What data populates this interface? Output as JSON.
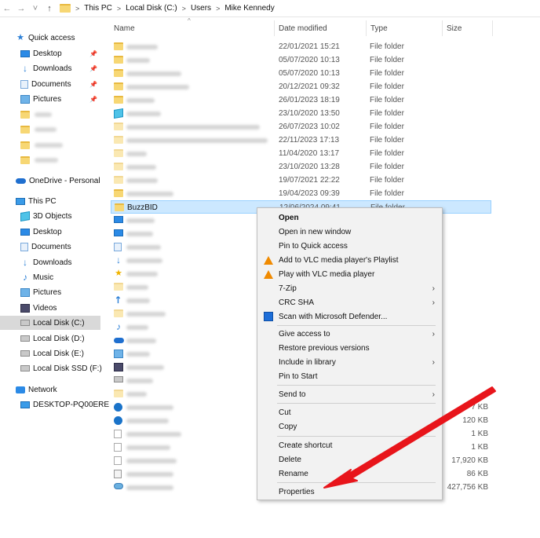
{
  "breadcrumb": [
    "This PC",
    "Local Disk (C:)",
    "Users",
    "Mike Kennedy"
  ],
  "columns": {
    "name": "Name",
    "date": "Date modified",
    "type": "Type",
    "size": "Size"
  },
  "sidebar": {
    "quick_access": "Quick access",
    "quick_items": [
      "Desktop",
      "Downloads",
      "Documents",
      "Pictures"
    ],
    "onedrive": "OneDrive - Personal",
    "this_pc": "This PC",
    "pc_items": [
      "3D Objects",
      "Desktop",
      "Documents",
      "Downloads",
      "Music",
      "Pictures",
      "Videos",
      "Local Disk (C:)",
      "Local Disk (D:)",
      "Local Disk (E:)",
      "Local Disk SSD (F:)"
    ],
    "network": "Network",
    "network_item": "DESKTOP-PQ00ERE"
  },
  "rows": [
    {
      "date": "22/01/2021 15:21",
      "type": "File folder",
      "size": ""
    },
    {
      "date": "05/07/2020 10:13",
      "type": "File folder",
      "size": ""
    },
    {
      "date": "05/07/2020 10:13",
      "type": "File folder",
      "size": ""
    },
    {
      "date": "20/12/2021 09:32",
      "type": "File folder",
      "size": ""
    },
    {
      "date": "26/01/2023 18:19",
      "type": "File folder",
      "size": ""
    },
    {
      "date": "23/10/2020 13:50",
      "type": "File folder",
      "size": ""
    },
    {
      "date": "26/07/2023 10:02",
      "type": "File folder",
      "size": ""
    },
    {
      "date": "22/11/2023 17:13",
      "type": "File folder",
      "size": ""
    },
    {
      "date": "11/04/2020 13:17",
      "type": "File folder",
      "size": ""
    },
    {
      "date": "23/10/2020 13:28",
      "type": "File folder",
      "size": ""
    },
    {
      "date": "19/07/2021 22:22",
      "type": "File folder",
      "size": ""
    },
    {
      "date": "19/04/2023 09:39",
      "type": "File folder",
      "size": ""
    },
    {
      "name": "BuzzBID",
      "date": "12/06/2024 09:41",
      "type": "File folder",
      "size": ""
    },
    {
      "size": "7 KB"
    },
    {
      "size": "120 KB"
    },
    {
      "size": "1 KB"
    },
    {
      "size": "1 KB"
    },
    {
      "size": "17,920 KB"
    },
    {
      "size": "86 KB"
    },
    {
      "size": "427,756 KB"
    }
  ],
  "context_menu": {
    "open": "Open",
    "open_new_window": "Open in new window",
    "pin_quick_access": "Pin to Quick access",
    "vlc_playlist": "Add to VLC media player's Playlist",
    "vlc_play": "Play with VLC media player",
    "zip": "7-Zip",
    "crc": "CRC SHA",
    "defender": "Scan with Microsoft Defender...",
    "give_access": "Give access to",
    "restore": "Restore previous versions",
    "include_library": "Include in library",
    "pin_start": "Pin to Start",
    "send_to": "Send to",
    "cut": "Cut",
    "copy": "Copy",
    "create_shortcut": "Create shortcut",
    "delete": "Delete",
    "rename": "Rename",
    "properties": "Properties"
  },
  "colors": {
    "selection": "#cce8ff",
    "annotation_arrow": "#e8151b",
    "folder": "#f7d774"
  }
}
